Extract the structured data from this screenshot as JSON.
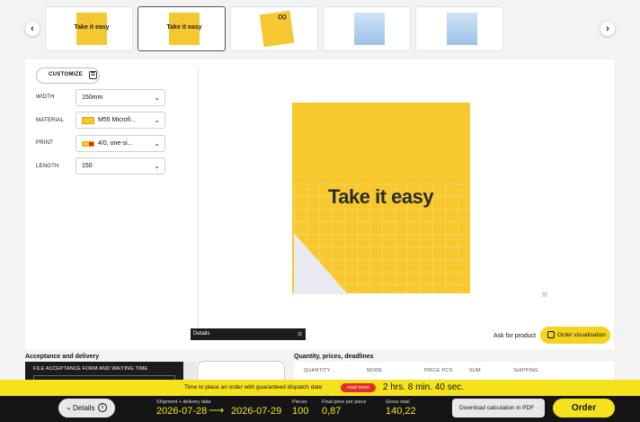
{
  "carousel": {
    "prev_icon": "‹",
    "next_icon": "›",
    "thumbs": [
      {
        "caption": "Take it easy"
      },
      {
        "caption": "Take it easy"
      },
      {
        "caption": ""
      },
      {
        "caption": ""
      },
      {
        "caption": ""
      }
    ]
  },
  "config": {
    "customize_label": "CUSTOMIZE",
    "customize_icon": "⧉",
    "width_label": "WIDTH",
    "width_value": "150mm",
    "material_label": "MATERIAL",
    "material_value": "M55 Microfi...",
    "print_label": "PRINT",
    "print_value": "4/0, one-si...",
    "length_label": "LENGTH",
    "length_value": "150",
    "chevron": "⌄"
  },
  "preview": {
    "product_text": "Take it easy",
    "details_label": "Details",
    "details_icon": "⊙",
    "ask_label": "Ask for product",
    "order_vis_label": "Order visualisation"
  },
  "acceptance": {
    "title": "Acceptance and delivery",
    "file_label": "FILE ACCEPTANCE FORM AND WAITING TIME"
  },
  "quantity": {
    "title": "Quantity, prices, deadlines",
    "columns": [
      "QUANTITY",
      "MODE",
      "PRICE PCS",
      "SUM",
      "SHIPPING"
    ]
  },
  "dispatch": {
    "message": "Time to place an order with guaranteed dispatch date",
    "read_more": "read more",
    "timer": "2 hrs. 8 min. 40 sec."
  },
  "footer": {
    "details_label": "Details",
    "details_chevron": "⌄",
    "info_icon": "i",
    "shipment_label": "Shipment + delivery date",
    "shipment_date": "2026-07-28",
    "arrow": "⟶",
    "delivery_date": "2026-07-29",
    "pieces_label": "Pieces",
    "pieces_value": "100",
    "final_price_label": "Final price per piece",
    "final_price_value": "0,87",
    "gross_label": "Gross total",
    "gross_value": "140,22",
    "pdf_label": "Download calculation in PDF",
    "order_label": "Order"
  },
  "colors": {
    "accent": "#f5e21f",
    "product": "#f7c92e",
    "footer_bg": "#151515",
    "read_more": "#e52b2b"
  }
}
